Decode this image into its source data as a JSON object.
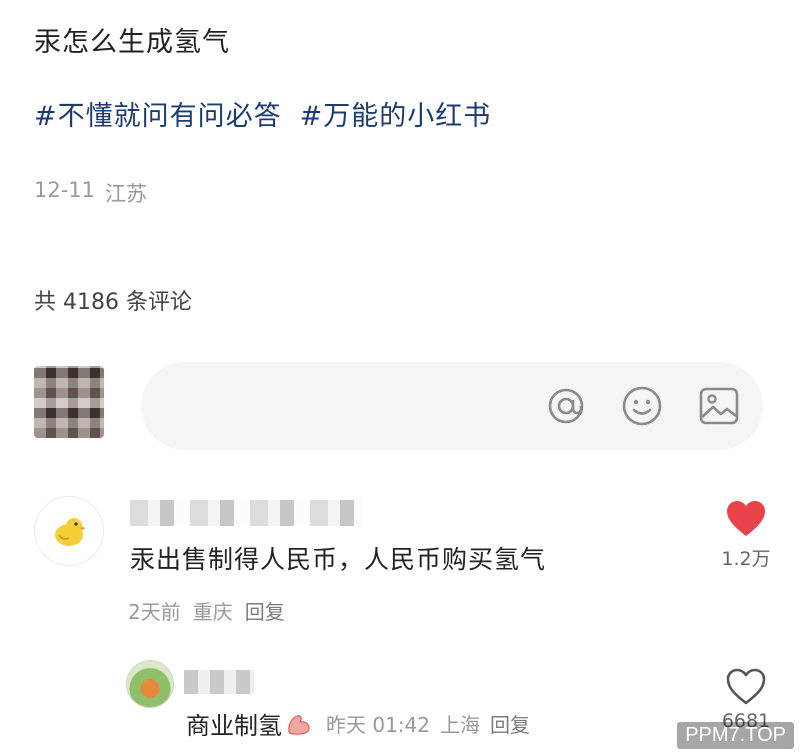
{
  "post": {
    "title": "汞怎么生成氢气",
    "tags": [
      "#不懂就问有问必答",
      "#万能的小红书"
    ],
    "date": "12-11",
    "location": "江苏"
  },
  "comments_header": {
    "count_text": "共 4186 条评论"
  },
  "input": {
    "icons": [
      "at-icon",
      "smile-icon",
      "image-icon"
    ]
  },
  "comments": [
    {
      "text": "汞出售制得人民币，人民币购买氢气",
      "time": "2天前",
      "location": "重庆",
      "reply_label": "回复",
      "like_count": "1.2万",
      "liked": true
    }
  ],
  "replies": [
    {
      "text": "商业制氢",
      "emoji": "muscle-icon",
      "time": "昨天 01:42",
      "location": "上海",
      "reply_label": "回复",
      "like_count": "6681",
      "liked": false
    }
  ],
  "watermark": {
    "text": "PPM7.TOP"
  },
  "colors": {
    "tag": "#1e3c72",
    "meta_gray": "#9a9a9a",
    "like_red": "#e8434b"
  }
}
